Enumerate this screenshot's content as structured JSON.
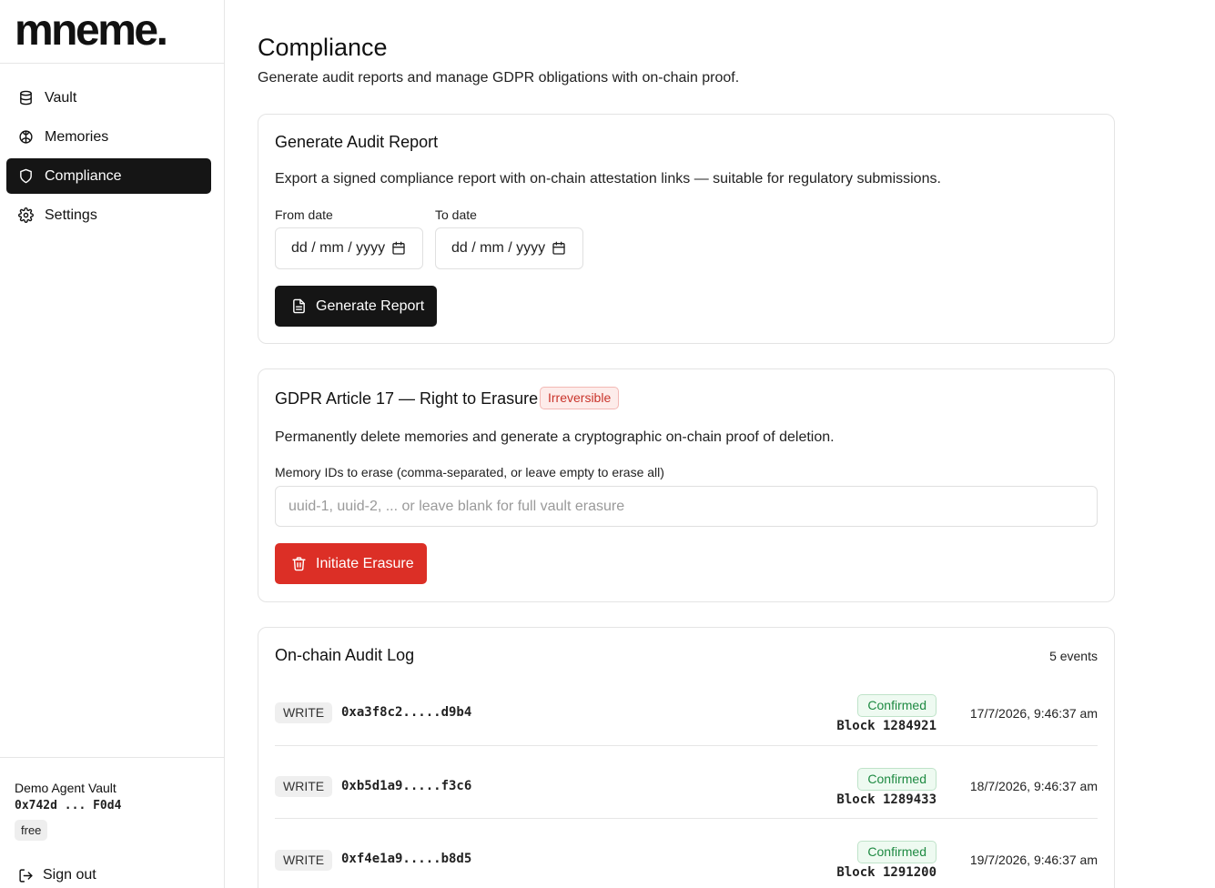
{
  "brand": {
    "logo_text": "mneme."
  },
  "sidebar": {
    "items": [
      {
        "label": "Vault",
        "icon": "database-icon",
        "active": false
      },
      {
        "label": "Memories",
        "icon": "brain-icon",
        "active": false
      },
      {
        "label": "Compliance",
        "icon": "shield-icon",
        "active": true
      },
      {
        "label": "Settings",
        "icon": "gear-icon",
        "active": false
      }
    ],
    "vault_name": "Demo Agent Vault",
    "vault_address": "0x742d ... F0d4",
    "plan": "free",
    "sign_out": "Sign out"
  },
  "page": {
    "title": "Compliance",
    "subtitle": "Generate audit reports and manage GDPR obligations with on-chain proof."
  },
  "audit_report": {
    "title": "Generate Audit Report",
    "description": "Export a signed compliance report with on-chain attestation links — suitable for regulatory submissions.",
    "from_label": "From date",
    "to_label": "To date",
    "from_value": "dd / mm / yyyy",
    "to_value": "dd / mm / yyyy",
    "button_label": "Generate Report"
  },
  "erasure": {
    "title": "GDPR Article 17 — Right to Erasure",
    "badge": "Irreversible",
    "description": "Permanently delete memories and generate a cryptographic on-chain proof of deletion.",
    "field_label": "Memory IDs to erase (comma-separated, or leave empty to erase all)",
    "placeholder": "uuid-1, uuid-2, ... or leave blank for full vault erasure",
    "value": "",
    "button_label": "Initiate Erasure"
  },
  "audit_log": {
    "title": "On-chain Audit Log",
    "count": "5 events",
    "rows": [
      {
        "op": "WRITE",
        "hash": "0xa3f8c2.....d9b4",
        "status": "Confirmed",
        "block": "Block 1284921",
        "time": "17/7/2026, 9:46:37 am"
      },
      {
        "op": "WRITE",
        "hash": "0xb5d1a9.....f3c6",
        "status": "Confirmed",
        "block": "Block 1289433",
        "time": "18/7/2026, 9:46:37 am"
      },
      {
        "op": "WRITE",
        "hash": "0xf4e1a9.....b8d5",
        "status": "Confirmed",
        "block": "Block 1291200",
        "time": "19/7/2026, 9:46:37 am"
      }
    ]
  },
  "colors": {
    "active_nav": "#151515",
    "danger": "#dc2f26",
    "success": "#1e8a42"
  }
}
